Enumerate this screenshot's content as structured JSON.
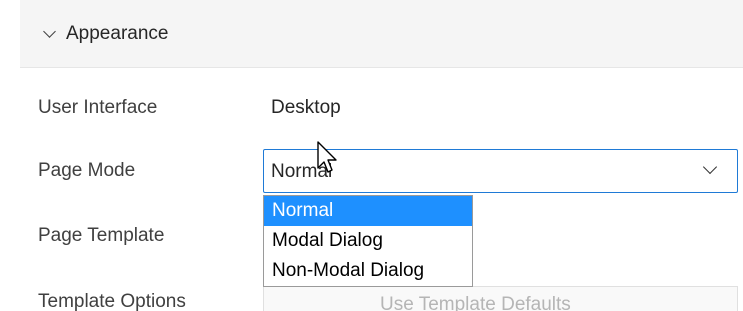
{
  "section": {
    "title": "Appearance",
    "icon": "chevron-down-icon"
  },
  "fields": {
    "user_interface": {
      "label": "User Interface",
      "value": "Desktop"
    },
    "page_mode": {
      "label": "Page Mode",
      "selected": "Normal",
      "options": [
        "Normal",
        "Modal Dialog",
        "Non-Modal Dialog"
      ]
    },
    "page_template": {
      "label": "Page Template"
    },
    "template_options": {
      "label": "Template Options",
      "value": "Use Template Defaults"
    }
  },
  "colors": {
    "highlight": "#1e90ff",
    "focus_border": "#1f7ad6",
    "header_bg": "#f5f5f5"
  }
}
